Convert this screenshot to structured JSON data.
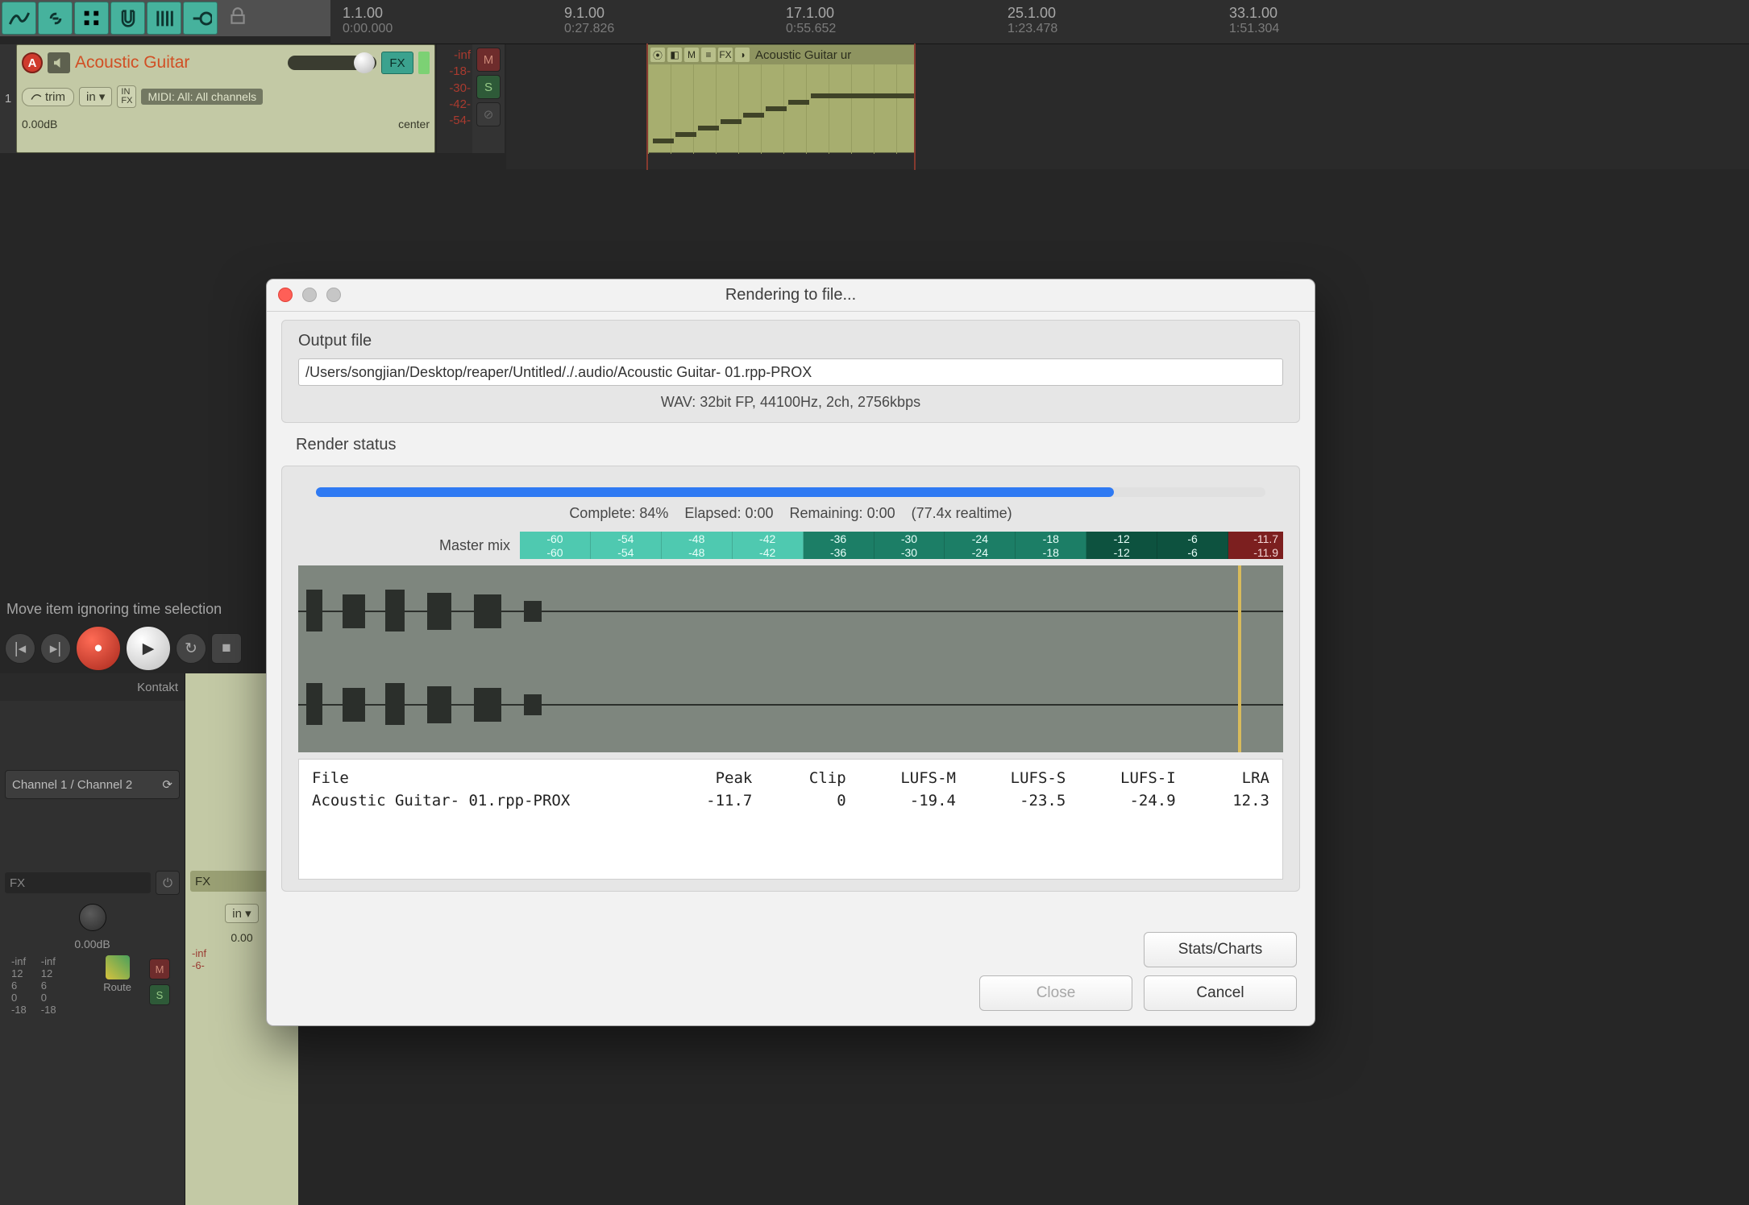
{
  "toolbar": {
    "lock_icon": "lock"
  },
  "ruler": [
    {
      "pos": 15,
      "bar": "1.1.00",
      "time": "0:00.000"
    },
    {
      "pos": 290,
      "bar": "9.1.00",
      "time": "0:27.826"
    },
    {
      "pos": 565,
      "bar": "17.1.00",
      "time": "0:55.652"
    },
    {
      "pos": 840,
      "bar": "25.1.00",
      "time": "1:23.478"
    },
    {
      "pos": 1115,
      "bar": "33.1.00",
      "time": "1:51.304"
    }
  ],
  "track": {
    "index": "1",
    "arm": "A",
    "name": "Acoustic Guitar",
    "fx": "FX",
    "trim": "trim",
    "in": "in",
    "infx_top": "IN",
    "infx_bot": "FX",
    "midi": "MIDI: All: All channels",
    "db": "0.00dB",
    "pan": "center",
    "scale_top": "-inf",
    "scale": [
      "-18-",
      "-30-",
      "-42-",
      "-54-"
    ],
    "m": "M",
    "s": "S"
  },
  "clip": {
    "icons": [
      "⦿",
      "◧",
      "M",
      "≡",
      "FX",
      "◑"
    ],
    "title": "Acoustic Guitar ur"
  },
  "status": "Move item ignoring time selection",
  "mixer": {
    "kontakt": "Kontakt",
    "channel": "Channel 1 / Channel 2",
    "fx": "FX",
    "zero": "0.00dB",
    "ninf": "-inf",
    "ticks": [
      "12",
      "6",
      "0",
      "-18"
    ],
    "route": "Route",
    "in": "in",
    "db2": "0.00",
    "ninf2": "-inf",
    "ticks2": [
      "-6-"
    ],
    "m": "M",
    "s": "S"
  },
  "dialog": {
    "title": "Rendering to file...",
    "output_label": "Output file",
    "path": "/Users/songjian/Desktop/reaper/Untitled/./.audio/Acoustic Guitar- 01.rpp-PROX",
    "format": "WAV: 32bit FP, 44100Hz, 2ch, 2756kbps",
    "status_label": "Render status",
    "progress": 84,
    "complete": "Complete: 84%",
    "elapsed": "Elapsed: 0:00",
    "remaining": "Remaining: 0:00",
    "realtime": "(77.4x realtime)",
    "master": "Master mix",
    "meter_labels_a": [
      "-60",
      "-54",
      "-48",
      "-42"
    ],
    "meter_labels_b": [
      "-36",
      "-30",
      "-24",
      "-18"
    ],
    "meter_labels_c": [
      "-12",
      "-6"
    ],
    "peak_top": "-11.7",
    "peak_bot": "-11.9",
    "table": {
      "headers": [
        "File",
        "Peak",
        "Clip",
        "LUFS-M",
        "LUFS-S",
        "LUFS-I",
        "LRA"
      ],
      "row": [
        "Acoustic Guitar- 01.rpp-PROX",
        "-11.7",
        "0",
        "-19.4",
        "-23.5",
        "-24.9",
        "12.3"
      ]
    },
    "stats": "Stats/Charts",
    "close": "Close",
    "cancel": "Cancel"
  }
}
